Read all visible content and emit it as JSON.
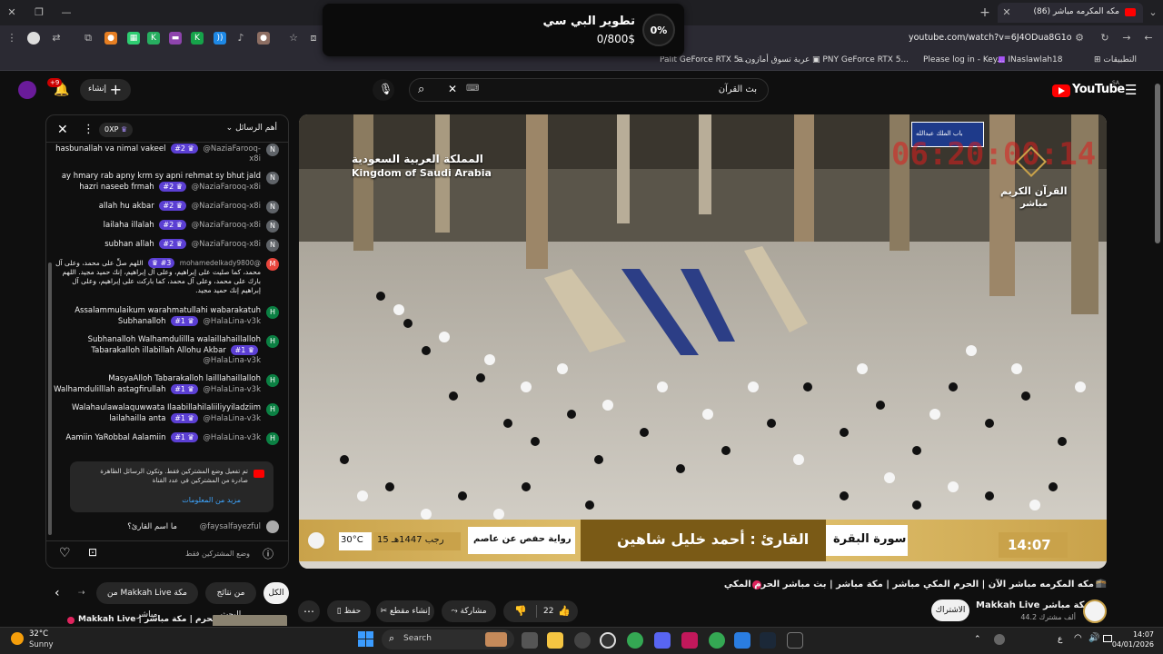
{
  "browser": {
    "tab_title": "مكه المكرمه مباشر (86)",
    "tab_count_badge": "",
    "url": "youtube.com/watch?v=6J4ODua8G1o",
    "bookmarks": [
      "التطبيقات",
      "INaslawlah18",
      "Please log in - Key...",
      "PNY GeForce RTX 5...",
      "عربة تسوق أمازون",
      "Palit GeForce RTX 5..."
    ]
  },
  "popup": {
    "percent": "0%",
    "title": "تطوير البي سي",
    "amount": "0/800$"
  },
  "youtube": {
    "logo_text": "YouTube",
    "region": "SA",
    "search_value": "بث القرآن",
    "create_label": "إنشاء",
    "notif_count": "+9"
  },
  "chat": {
    "header_title": "أهم الرسائل",
    "xp_label": "0XP",
    "messages": [
      {
        "author": "@NaziaFarooq-x8i",
        "badge": "#2",
        "text": "hasbunallah va nimal vakeel",
        "avatar": "N",
        "color": "#5f6368"
      },
      {
        "author": "@NaziaFarooq-x8i",
        "badge": "#2",
        "text": "ay hmary rab apny krm sy apni rehmat sy bhut jald hazri naseeb frmah",
        "avatar": "N",
        "color": "#5f6368"
      },
      {
        "author": "@NaziaFarooq-x8i",
        "badge": "#2",
        "text": "allah hu akbar",
        "avatar": "N",
        "color": "#5f6368"
      },
      {
        "author": "@NaziaFarooq-x8i",
        "badge": "#2",
        "text": "lailaha illalah",
        "avatar": "N",
        "color": "#5f6368"
      },
      {
        "author": "@NaziaFarooq-x8i",
        "badge": "#2",
        "text": "subhan allah",
        "avatar": "N",
        "color": "#5f6368"
      },
      {
        "author": "@mohamedelkady9800",
        "badge": "#3",
        "text": "اللهم صلِّ على محمد، وعلى آل محمد، كما صليت على إبراهيم، وعلى آل إبراهيم، إنك حميد مجيد. اللهم بارك على محمد، وعلى آل محمد، كما باركت على إبراهيم، وعلى آل إبراهيم إنك حميد مجيد.",
        "avatar": "M",
        "color": "#e8453c"
      },
      {
        "author": "@HalaLina-v3k",
        "badge": "#1",
        "text": "Assalammulaikum warahmatullahi wabarakatuh Subhanalloh",
        "avatar": "H",
        "color": "#0b8043"
      },
      {
        "author": "@HalaLina-v3k",
        "badge": "#1",
        "text": "Subhanalloh Walhamdulillla walaillahaillalloh Tabarakalloh illabillah Allohu Akbar",
        "avatar": "H",
        "color": "#0b8043"
      },
      {
        "author": "@HalaLina-v3k",
        "badge": "#1",
        "text": "MasyaAlloh Tabarakalloh lailllahaillalloh Walhamdulilllah astagfirullah",
        "avatar": "H",
        "color": "#0b8043"
      },
      {
        "author": "@HalaLina-v3k",
        "badge": "#1",
        "text": "Walahaulawalaquwwata Ilaabillahilaliiliyyiladziim lailahailla anta",
        "avatar": "H",
        "color": "#0b8043"
      },
      {
        "author": "@HalaLina-v3k",
        "badge": "#1",
        "text": "Aamiin YaRobbal Aalamiin",
        "avatar": "H",
        "color": "#0b8043"
      }
    ],
    "notice_text": "تم تفعيل وضع المشتركين فقط. وتكون الرسائل الظاهرة صادرة من المشتركين في عدد القناة",
    "notice_link": "مزيد من المعلومات",
    "last_message": {
      "author": "@faysalfayezful",
      "text": "ما اسم القارئ؟"
    },
    "subscribers_only": "وضع المشتركين فقط"
  },
  "video": {
    "channel_overlay_ar": "المملكة العربية السعودية",
    "channel_overlay_en": "Kingdom of Saudi Arabia",
    "quran_logo_ar": "القرآن الكريم",
    "live_label_ar": "مباشر",
    "countdown": "06:20:00:14",
    "sign_text": "باب الملك عبدالله",
    "surah": "سورة البقرة",
    "reciter": "القارئ : أحمد خليل شاهين",
    "riwaya": "رواية حفص عن عاصم",
    "hijri_date": "15 رجب 1447هـ",
    "temp": "30°C",
    "time": "14:07"
  },
  "below_video": {
    "chips": [
      "الكل",
      "من نتائج البحث",
      "من Makkah Live مكة مباشر"
    ],
    "title": "مكه المكرمه مباشر الآن | الحرم المكي مباشر | مكة مباشر | بث مباشر الحرم المكي",
    "channel_name": "Makkah Live مكة مباشر",
    "subscribers": "44.2 ألف مشترك",
    "subscribe_label": "الاشتراك",
    "likes": "22",
    "share_label": "مشاركة",
    "clip_label": "إنشاء مقطع",
    "save_label": "حفظ",
    "next_item": "Makkah Live | الحرم | مكة مباشر"
  },
  "taskbar": {
    "weather_temp": "32°C",
    "weather_desc": "Sunny",
    "search_label": "Search",
    "clock_time": "14:07",
    "clock_date": "04/01/2026",
    "lang": "ع"
  }
}
